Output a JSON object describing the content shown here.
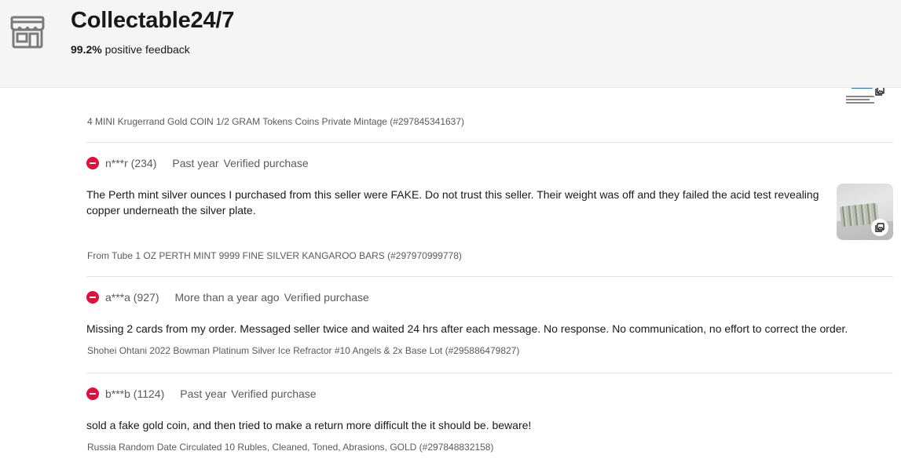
{
  "seller": {
    "name": "Collectable24/7",
    "feedback_percent": "99.2%",
    "feedback_label": "positive feedback"
  },
  "top_item": {
    "title": "4 MINI Krugerrand Gold COIN 1/2 GRAM Tokens Coins Private Mintage (#297845341637)"
  },
  "reviews": [
    {
      "user": "n***r (234)",
      "time": "Past year",
      "verified": "Verified purchase",
      "text_line1": "The Perth mint silver ounces I purchased from this seller were FAKE. Do not trust this seller. Their weight was off and they failed the acid test revealing",
      "text_line2": "copper underneath the silver plate.",
      "item": "From Tube 1 OZ PERTH MINT 9999 FINE SILVER KANGAROO BARS (#297970999778)"
    },
    {
      "user": "a***a (927)",
      "time": "More than a year ago",
      "verified": "Verified purchase",
      "text": "Missing 2 cards from my order. Messaged seller twice and waited 24 hrs after each message. No response. No communication, no effort to correct the order.",
      "item": "Shohei Ohtani 2022 Bowman Platinum Silver Ice Refractor #10 Angels & 2x Base Lot (#295886479827)"
    },
    {
      "user": "b***b (1124)",
      "time": "Past year",
      "verified": "Verified purchase",
      "text": "sold a fake gold coin, and then tried to make a return more difficult the it should be. beware!",
      "item": "Russia Random Date Circulated 10 Rubles, Cleaned, Toned, Abrasions, GOLD (#297848832158)"
    }
  ],
  "icons": {
    "store": "store-icon",
    "negative": "negative-feedback-icon",
    "gallery": "gallery-icon"
  },
  "colors": {
    "negative": "#e0103a",
    "header_bg": "#f5f5f5",
    "text": "#191919",
    "muted": "#5a5a5a"
  }
}
